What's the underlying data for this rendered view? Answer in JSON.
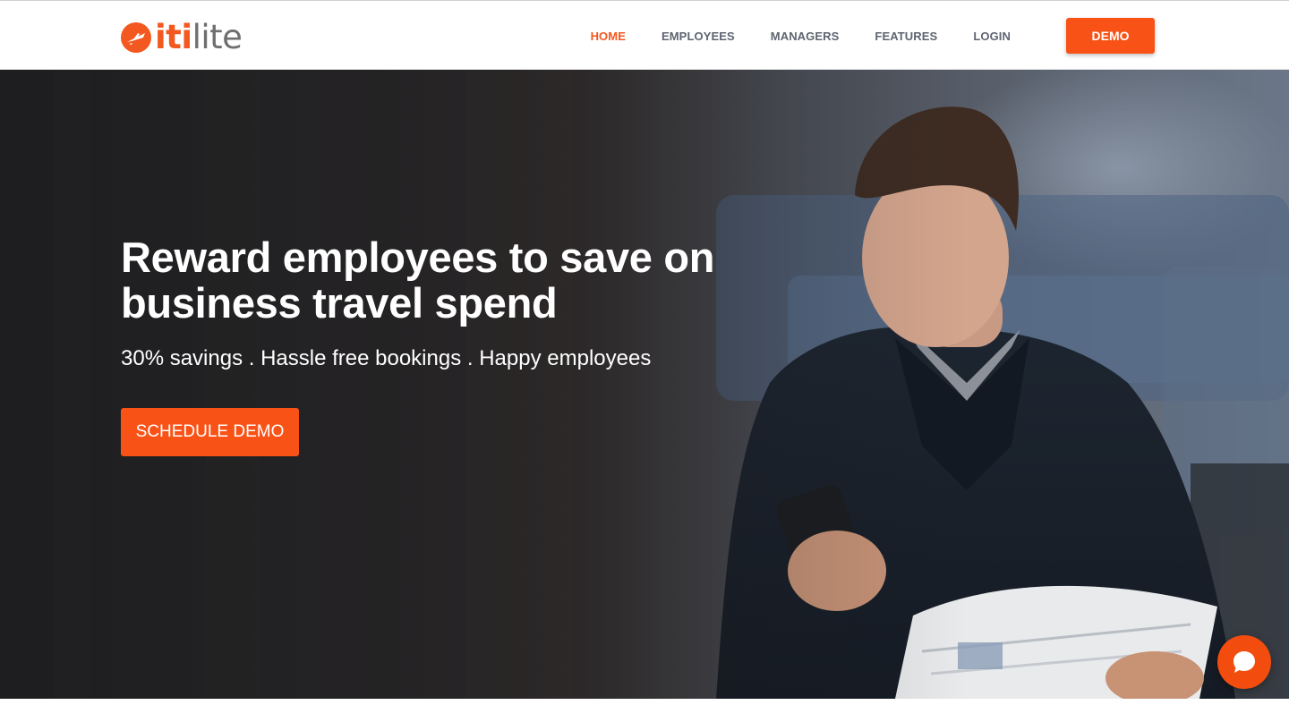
{
  "brand": {
    "logo_iti": "iti",
    "logo_lite": "lite",
    "accent": "#f95216",
    "icon": "plane-logo-icon"
  },
  "nav": {
    "items": [
      {
        "label": "HOME",
        "active": true
      },
      {
        "label": "EMPLOYEES",
        "active": false
      },
      {
        "label": "MANAGERS",
        "active": false
      },
      {
        "label": "FEATURES",
        "active": false
      },
      {
        "label": "LOGIN",
        "active": false
      }
    ],
    "demo_label": "DEMO"
  },
  "hero": {
    "title": "Reward employees to save on business travel spend",
    "subtitle": "30% savings . Hassle free bookings . Happy employees",
    "cta_label": "SCHEDULE DEMO"
  },
  "chat": {
    "icon": "chat-bubble-icon"
  }
}
